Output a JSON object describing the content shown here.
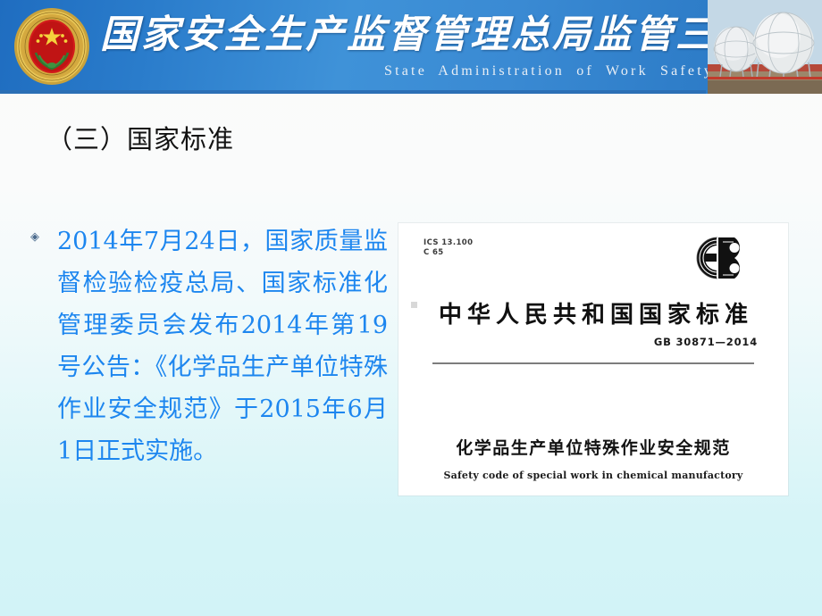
{
  "banner": {
    "title_cn": "国家安全生产监督管理总局监管三司",
    "subtitle_en": "State  Administration  of  Work  Safety",
    "emblem_icon": "national-emblem-icon",
    "photo_icon": "spherical-storage-tanks-photo",
    "bg_color": "#2f7ecb",
    "underline_color": "#2b6fb5"
  },
  "slide": {
    "title": "（三）国家标准",
    "title_color": "#121212",
    "bullet_marker": "◈",
    "bullet_text": "2014年7月24日，国家质量监督检验检疫总局、国家标准化管理委员会发布2014年第19号公告：《化学品生产单位特殊作业安全规范》于2015年6月1日正式实施。",
    "bullet_text_color": "#1d86ef"
  },
  "document": {
    "ics_line1": "ICS 13.100",
    "ics_line2": "C 65",
    "gb_logo_text": "GB",
    "main_title": "中华人民共和国国家标准",
    "standard_number": "GB 30871—2014",
    "cn_subject": "化学品生产单位特殊作业安全规范",
    "en_subject": "Safety code of special work in chemical manufactory"
  }
}
